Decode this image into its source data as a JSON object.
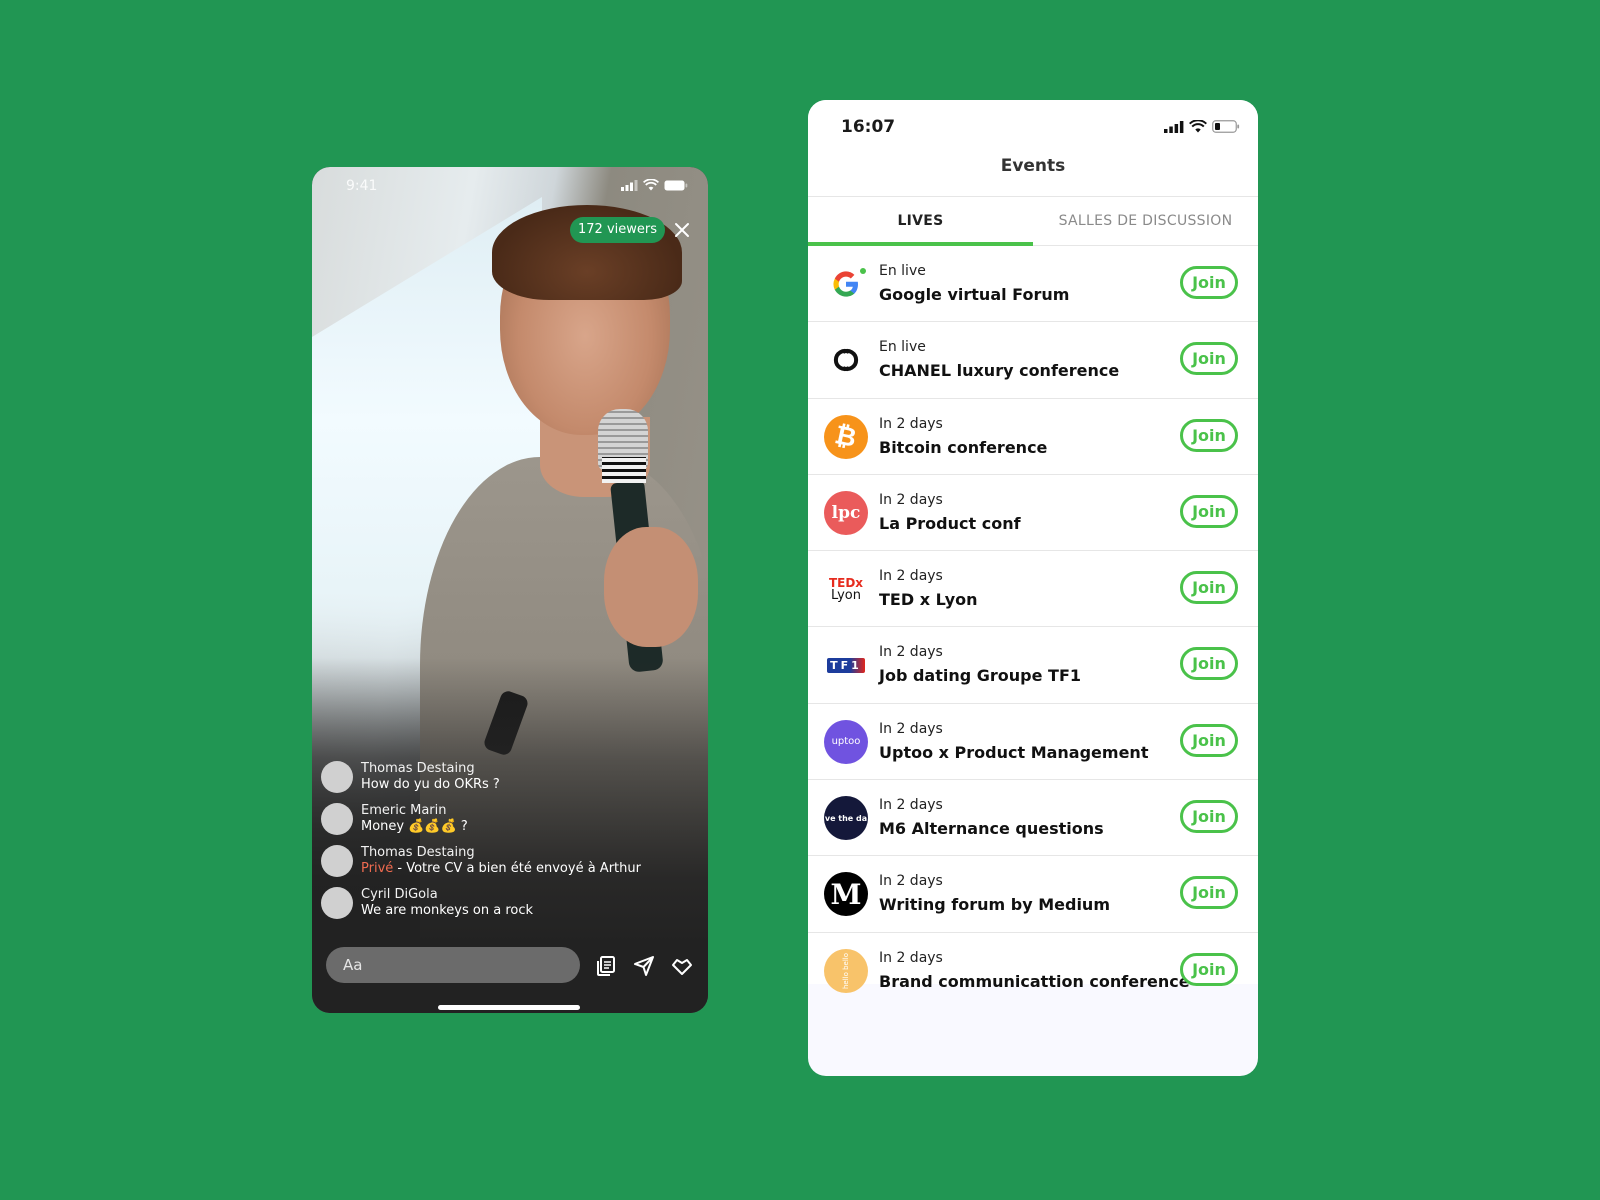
{
  "live_screen": {
    "status_time": "9:41",
    "viewers": "172 viewers",
    "chat": [
      {
        "author": "Thomas Destaing",
        "message": "How do yu do OKRs ?"
      },
      {
        "author": "Emeric Marin",
        "message": "Money 💰💰💰 ?"
      },
      {
        "author": "Thomas Destaing",
        "prefix": "Privé",
        "message": " - Votre CV a bien été envoyé à Arthur"
      },
      {
        "author": "Cyril DiGola",
        "message": "We are monkeys on a rock"
      }
    ],
    "input_placeholder": "Aa",
    "icons": [
      "cv-document-icon",
      "send-icon",
      "heart-icon"
    ]
  },
  "events_screen": {
    "status_time": "16:07",
    "title": "Events",
    "tabs": [
      {
        "label": "LIVES",
        "active": true
      },
      {
        "label": "SALLES DE DISCUSSION",
        "active": false
      }
    ],
    "join_label": "Join",
    "events": [
      {
        "when": "En live",
        "name": "Google virtual Forum",
        "logo": "google-logo",
        "live": true
      },
      {
        "when": "En live",
        "name": "CHANEL luxury conference",
        "logo": "chanel-logo",
        "live": true
      },
      {
        "when": "In 2 days",
        "name": "Bitcoin conference",
        "logo": "bitcoin-logo",
        "live": false
      },
      {
        "when": "In 2 days",
        "name": "La Product conf",
        "logo": "lpc-logo",
        "logo_text": "lpc",
        "live": false
      },
      {
        "when": "In 2 days",
        "name": "TED x Lyon",
        "logo": "tedx-lyon-logo",
        "logo_text": "TEDx",
        "logo_sub": "Lyon",
        "live": false
      },
      {
        "when": "In 2 days",
        "name": "Job dating Groupe TF1",
        "logo": "tf1-logo",
        "logo_text": "TF1",
        "live": false
      },
      {
        "when": "In 2 days",
        "name": "Uptoo x Product Management",
        "logo": "uptoo-logo",
        "logo_text": "uptoo",
        "live": false
      },
      {
        "when": "In 2 days",
        "name": "M6 Alternance questions",
        "logo": "m6-logo",
        "logo_text": "ve the da",
        "live": false
      },
      {
        "when": "In 2 days",
        "name": "Writing forum by Medium",
        "logo": "medium-logo",
        "logo_text": "M",
        "live": false
      },
      {
        "when": "In 2 days",
        "name": "Brand communicattion conference",
        "logo": "hello-bello-logo",
        "logo_text": "hello bello",
        "live": false
      }
    ]
  },
  "colors": {
    "background": "#219653",
    "accent_green": "#4ac24a",
    "private_red": "#f06b50"
  }
}
